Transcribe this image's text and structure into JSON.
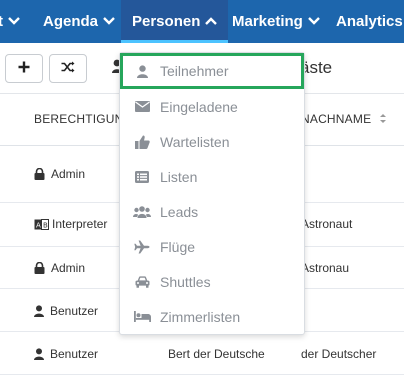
{
  "nav": {
    "items": [
      {
        "label": "t",
        "chevron": "chevron-down-icon"
      },
      {
        "label": "Agenda",
        "chevron": "chevron-down-icon"
      },
      {
        "label": "Personen",
        "chevron": "chevron-up-icon",
        "active": true
      },
      {
        "label": "Marketing",
        "chevron": "chevron-down-icon"
      },
      {
        "label": "Analytics",
        "chevron": "chevron-down-icon"
      }
    ]
  },
  "toolbar": {
    "add_icon": "plus-icon",
    "shuffle_icon": "shuffle-icon",
    "title_partial": "äste"
  },
  "table": {
    "headers": {
      "permission": "BERECHTIGUNG",
      "lastname": "NACHNAME"
    },
    "rows": [
      {
        "permission": "Admin",
        "perm_icon": "lock-icon",
        "firstname": "",
        "lastname": ""
      },
      {
        "permission": "Interpreter",
        "perm_icon": "translate-icon",
        "firstname": "",
        "lastname": "Astronaut"
      },
      {
        "permission": "Admin",
        "perm_icon": "lock-icon",
        "firstname": "",
        "lastname": "Astronau"
      },
      {
        "permission": "Benutzer",
        "perm_icon": "user-icon",
        "firstname": "",
        "lastname": ""
      },
      {
        "permission": "Benutzer",
        "perm_icon": "user-icon",
        "firstname": "Bert der Deutsche",
        "lastname": "der Deutscher"
      }
    ]
  },
  "dropdown": {
    "items": [
      {
        "label": "Teilnehmer",
        "icon": "user-icon",
        "highlighted": true
      },
      {
        "label": "Eingeladene",
        "icon": "envelope-icon"
      },
      {
        "label": "Wartelisten",
        "icon": "thumbs-up-icon"
      },
      {
        "label": "Listen",
        "icon": "list-icon"
      },
      {
        "label": "Leads",
        "icon": "users-icon"
      },
      {
        "label": "Flüge",
        "icon": "plane-icon"
      },
      {
        "label": "Shuttles",
        "icon": "car-icon"
      },
      {
        "label": "Zimmerlisten",
        "icon": "bed-icon"
      }
    ]
  },
  "colors": {
    "nav_bg": "#1d66ad",
    "nav_active": "#24579a",
    "highlight_border": "#26a65b",
    "menu_text": "#8a8f96"
  }
}
